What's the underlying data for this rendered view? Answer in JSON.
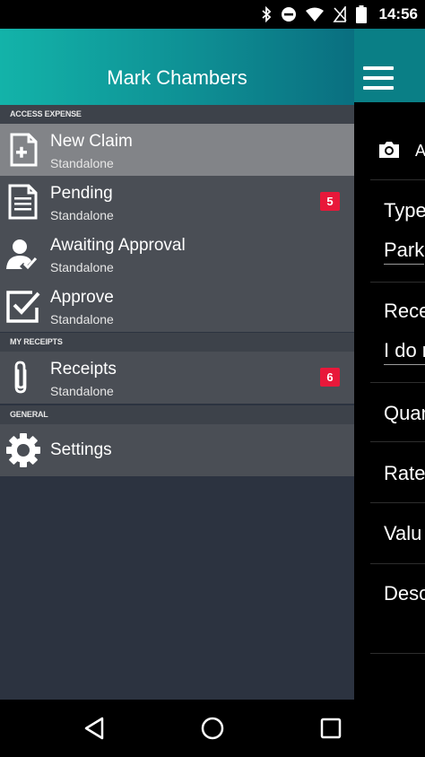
{
  "status_bar": {
    "time": "14:56",
    "icons": [
      "bluetooth-icon",
      "dnd-icon",
      "wifi-icon",
      "no-sim-icon",
      "battery-icon"
    ]
  },
  "drawer": {
    "user_name": "Mark Chambers",
    "sections": [
      {
        "label": "ACCESS EXPENSE",
        "items": [
          {
            "title": "New Claim",
            "subtitle": "Standalone",
            "icon": "new-claim-icon",
            "selected": true
          },
          {
            "title": "Pending",
            "subtitle": "Standalone",
            "icon": "document-icon",
            "badge": "5"
          },
          {
            "title": "Awaiting Approval",
            "subtitle": "Standalone",
            "icon": "user-check-icon"
          },
          {
            "title": "Approve",
            "subtitle": "Standalone",
            "icon": "checkbox-icon"
          }
        ]
      },
      {
        "label": "MY RECEIPTS",
        "items": [
          {
            "title": "Receipts",
            "subtitle": "Standalone",
            "icon": "paperclip-icon",
            "badge": "6"
          }
        ]
      },
      {
        "label": "GENERAL",
        "items": [
          {
            "title": "Settings",
            "icon": "gear-icon"
          }
        ]
      }
    ]
  },
  "background_form": {
    "camera_label": "A",
    "type_label": "Type",
    "type_value": "Park",
    "receipt_label": "Rece",
    "receipt_value": "I do r",
    "quantity_label": "Quan",
    "rate_label": "Rate",
    "value_label": "Valu",
    "description_label": "Desc"
  },
  "colors": {
    "header_start": "#13b3a9",
    "header_end": "#0a6f80",
    "drawer_bg": "#2c3340",
    "item_bg": "#4a4e55",
    "selected_bg": "#828488",
    "badge": "#e8183a"
  },
  "nav_bar": {
    "buttons": [
      "back-icon",
      "home-icon",
      "recents-icon"
    ]
  }
}
